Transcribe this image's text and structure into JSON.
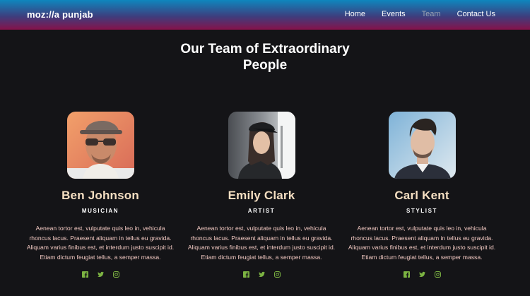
{
  "brand": "moz://a punjab",
  "nav": [
    {
      "label": "Home",
      "active": false
    },
    {
      "label": "Events",
      "active": false
    },
    {
      "label": "Team",
      "active": true
    },
    {
      "label": "Contact Us",
      "active": false
    }
  ],
  "title_line1": "Our Team of Extraordinary",
  "title_line2": "People",
  "colors": {
    "accent_name": "#f5dfc2",
    "bio": "#f2c9c2",
    "social": "#7cb342",
    "nav_inactive": "#9aa3b3"
  },
  "team": [
    {
      "name": "Ben Johnson",
      "role": "MUSICIAN",
      "bio": "Aenean tortor est, vulputate quis leo in, vehicula rhoncus lacus. Praesent aliquam in tellus eu gravida. Aliquam varius finibus est, et interdum justo suscipit id. Etiam dictum feugiat tellus, a semper massa.",
      "socials": [
        "facebook-icon",
        "twitter-icon",
        "instagram-icon"
      ]
    },
    {
      "name": "Emily Clark",
      "role": "ARTIST",
      "bio": "Aenean tortor est, vulputate quis leo in, vehicula rhoncus lacus. Praesent aliquam in tellus eu gravida. Aliquam varius finibus est, et interdum justo suscipit id. Etiam dictum feugiat tellus, a semper massa.",
      "socials": [
        "facebook-icon",
        "twitter-icon",
        "instagram-icon"
      ]
    },
    {
      "name": "Carl Kent",
      "role": "STYLIST",
      "bio": "Aenean tortor est, vulputate quis leo in, vehicula rhoncus lacus. Praesent aliquam in tellus eu gravida. Aliquam varius finibus est, et interdum justo suscipit id. Etiam dictum feugiat tellus, a semper massa.",
      "socials": [
        "facebook-icon",
        "twitter-icon",
        "instagram-icon"
      ]
    }
  ]
}
